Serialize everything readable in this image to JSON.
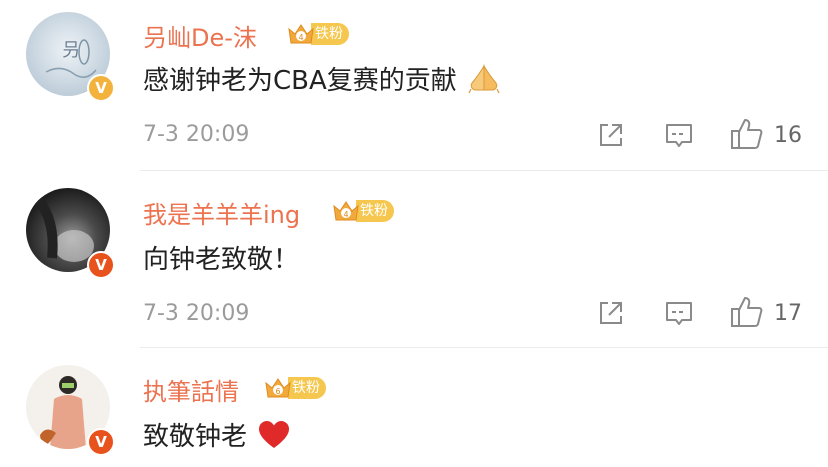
{
  "comments": [
    {
      "username": "叧屾De-沫",
      "fan_badge": "铁粉",
      "fan_level": "4",
      "text": "感谢钟老为CBA复赛的贡献",
      "emoji": "folded-hands-emoji",
      "time": "7-3 20:09",
      "likes": "16",
      "avatar_text": "叧"
    },
    {
      "username": "我是羊羊羊ing",
      "fan_badge": "铁粉",
      "fan_level": "4",
      "text": "向钟老致敬！",
      "time": "7-3 20:09",
      "likes": "17"
    },
    {
      "username": "执筆話情",
      "fan_badge": "铁粉",
      "fan_level": "6",
      "text": "致敬钟老",
      "emoji": "red-heart-emoji"
    }
  ],
  "verified_mark": "V",
  "colors": {
    "username": "#eb7350",
    "fan_badge": "#f6c74e",
    "verified_gold": "#f3b23b",
    "verified_red": "#e8521c"
  }
}
